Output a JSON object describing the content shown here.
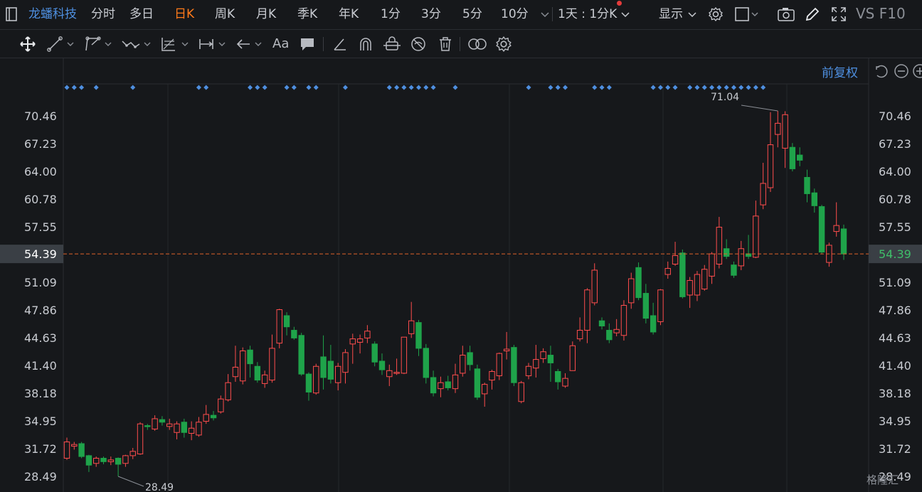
{
  "header": {
    "stock_name": "龙蟠科技",
    "tabs": [
      "分时",
      "多日",
      "日K",
      "周K",
      "月K",
      "季K",
      "年K",
      "1分",
      "3分",
      "5分",
      "10分"
    ],
    "active_tab": "日K",
    "period_selector": "1天 : 1分K",
    "display_label": "显示",
    "f10_label": "VS F10"
  },
  "toolbar": {
    "icons": [
      "move-icon",
      "line-icon",
      "polyline-icon",
      "wave-icon",
      "fib-icon",
      "measure-icon",
      "arrow-icon",
      "text-icon",
      "comment-icon",
      "pen-icon",
      "magnet-icon",
      "lock-icon",
      "hide-icon",
      "trash-icon",
      "link-icon",
      "settings-icon"
    ],
    "text_tool": "Aa"
  },
  "adjust_label": "前复权",
  "watermark": "格隆汇",
  "colors": {
    "up": "#ff4d4d",
    "down": "#1fa34a",
    "accent": "#4e8fe0",
    "active_tab": "#ff7a1a",
    "current_line": "#e0622a"
  },
  "chart_data": {
    "type": "candlestick",
    "ylim": [
      28.49,
      73.5
    ],
    "y_ticks": [
      "70.46",
      "67.23",
      "64.00",
      "60.78",
      "57.55",
      "54.39",
      "51.09",
      "47.86",
      "44.63",
      "41.40",
      "38.18",
      "34.95",
      "31.72",
      "28.49"
    ],
    "current_price": "54.39",
    "max_label": "71.04",
    "min_label": "28.49",
    "candles": [
      [
        30.6,
        32.5,
        33.0,
        30.4
      ],
      [
        32.0,
        32.2,
        32.5,
        31.6
      ],
      [
        32.3,
        30.8,
        32.5,
        30.6
      ],
      [
        30.9,
        29.8,
        31.0,
        29.0
      ],
      [
        30.0,
        30.6,
        30.8,
        29.6
      ],
      [
        30.6,
        30.2,
        30.8,
        29.9
      ],
      [
        30.2,
        30.4,
        30.8,
        29.8
      ],
      [
        30.6,
        29.9,
        30.7,
        28.49
      ],
      [
        30.0,
        30.9,
        31.0,
        29.6
      ],
      [
        30.9,
        31.4,
        31.8,
        30.5
      ],
      [
        31.1,
        34.6,
        34.8,
        31.0
      ],
      [
        34.4,
        34.3,
        34.6,
        33.9
      ],
      [
        34.0,
        35.2,
        35.6,
        33.8
      ],
      [
        35.1,
        34.8,
        35.5,
        34.4
      ],
      [
        34.3,
        34.6,
        35.2,
        33.9
      ],
      [
        33.6,
        34.6,
        34.9,
        32.8
      ],
      [
        34.8,
        33.6,
        35.2,
        33.0
      ],
      [
        33.5,
        34.1,
        34.9,
        32.7
      ],
      [
        33.3,
        34.8,
        35.4,
        33.1
      ],
      [
        34.9,
        35.7,
        36.8,
        34.6
      ],
      [
        35.6,
        35.3,
        36.1,
        35.0
      ],
      [
        36.0,
        37.5,
        37.9,
        35.8
      ],
      [
        37.4,
        39.4,
        40.4,
        37.2
      ],
      [
        40.1,
        41.2,
        43.7,
        39.5
      ],
      [
        39.6,
        43.1,
        43.5,
        39.2
      ],
      [
        43.2,
        41.6,
        43.7,
        40.0
      ],
      [
        41.3,
        39.7,
        41.8,
        39.4
      ],
      [
        39.3,
        40.3,
        40.8,
        38.8
      ],
      [
        39.7,
        43.4,
        45.0,
        39.4
      ],
      [
        44.0,
        47.9,
        48.0,
        43.4
      ],
      [
        47.2,
        45.9,
        47.6,
        44.9
      ],
      [
        45.5,
        44.6,
        45.9,
        44.4
      ],
      [
        44.9,
        40.4,
        45.2,
        40.2
      ],
      [
        40.4,
        38.3,
        40.6,
        37.3
      ],
      [
        38.2,
        41.3,
        41.6,
        38.0
      ],
      [
        42.4,
        40.0,
        44.9,
        38.6
      ],
      [
        41.9,
        39.8,
        43.8,
        39.3
      ],
      [
        39.4,
        41.3,
        41.7,
        38.5
      ],
      [
        40.6,
        42.9,
        43.3,
        39.3
      ],
      [
        43.9,
        44.5,
        45.1,
        41.6
      ],
      [
        44.1,
        44.5,
        45.0,
        42.8
      ],
      [
        44.6,
        45.4,
        46.1,
        44.0
      ],
      [
        43.9,
        41.8,
        44.2,
        41.3
      ],
      [
        41.9,
        40.9,
        42.8,
        40.3
      ],
      [
        40.1,
        40.8,
        41.5,
        39.0
      ],
      [
        40.6,
        40.6,
        42.2,
        40.3
      ],
      [
        40.5,
        44.7,
        44.7,
        40.4
      ],
      [
        45.1,
        46.6,
        48.8,
        44.6
      ],
      [
        46.4,
        43.4,
        46.7,
        42.5
      ],
      [
        43.4,
        40.0,
        43.9,
        39.3
      ],
      [
        40.0,
        38.2,
        40.8,
        37.8
      ],
      [
        38.7,
        39.4,
        40.1,
        37.7
      ],
      [
        39.5,
        38.8,
        40.2,
        38.5
      ],
      [
        38.7,
        40.3,
        41.6,
        38.2
      ],
      [
        40.5,
        42.6,
        43.7,
        40.1
      ],
      [
        42.9,
        41.5,
        43.7,
        40.8
      ],
      [
        41.0,
        37.7,
        41.5,
        37.4
      ],
      [
        38.1,
        39.2,
        39.4,
        36.6
      ],
      [
        39.7,
        40.7,
        40.9,
        38.6
      ],
      [
        40.2,
        42.8,
        42.9,
        39.7
      ],
      [
        43.1,
        43.3,
        45.3,
        42.1
      ],
      [
        43.5,
        39.4,
        43.8,
        39.0
      ],
      [
        37.2,
        39.4,
        39.6,
        37.0
      ],
      [
        40.2,
        41.3,
        41.7,
        39.8
      ],
      [
        41.1,
        42.1,
        43.8,
        40.0
      ],
      [
        42.2,
        43.0,
        43.4,
        41.7
      ],
      [
        42.6,
        41.7,
        43.7,
        39.5
      ],
      [
        40.7,
        39.5,
        41.0,
        38.6
      ],
      [
        39.0,
        39.9,
        40.5,
        38.8
      ],
      [
        40.8,
        43.7,
        44.2,
        40.8
      ],
      [
        44.5,
        45.5,
        47.0,
        44.2
      ],
      [
        45.5,
        50.2,
        50.4,
        44.0
      ],
      [
        48.7,
        52.5,
        53.3,
        48.4
      ],
      [
        46.6,
        46.0,
        47.0,
        45.6
      ],
      [
        45.5,
        44.4,
        46.3,
        44.0
      ],
      [
        45.2,
        45.6,
        46.8,
        44.8
      ],
      [
        44.9,
        48.4,
        49.0,
        44.3
      ],
      [
        48.7,
        51.5,
        52.2,
        48.0
      ],
      [
        52.8,
        49.3,
        53.4,
        49.0
      ],
      [
        49.8,
        46.9,
        50.9,
        46.3
      ],
      [
        47.2,
        45.3,
        48.7,
        45.0
      ],
      [
        46.5,
        50.2,
        50.3,
        46.1
      ],
      [
        52.0,
        52.7,
        53.5,
        51.5
      ],
      [
        53.2,
        54.2,
        55.8,
        53.0
      ],
      [
        54.5,
        49.4,
        54.9,
        49.2
      ],
      [
        49.6,
        51.3,
        51.7,
        48.1
      ],
      [
        49.6,
        52.0,
        52.4,
        48.9
      ],
      [
        50.3,
        52.6,
        53.1,
        50.1
      ],
      [
        51.8,
        54.4,
        54.6,
        50.9
      ],
      [
        53.2,
        57.5,
        58.7,
        52.7
      ],
      [
        55.0,
        54.1,
        56.1,
        53.8
      ],
      [
        53.1,
        51.9,
        53.5,
        51.6
      ],
      [
        53.0,
        55.0,
        55.9,
        52.5
      ],
      [
        54.4,
        54.1,
        56.6,
        53.8
      ],
      [
        54.0,
        58.8,
        60.6,
        53.9
      ],
      [
        60.1,
        62.6,
        65.0,
        59.6
      ],
      [
        62.1,
        67.1,
        70.9,
        61.6
      ],
      [
        68.3,
        69.6,
        71.04,
        66.8
      ],
      [
        66.7,
        70.6,
        71.0,
        64.4
      ],
      [
        66.8,
        64.3,
        67.3,
        64.0
      ],
      [
        65.9,
        65.3,
        66.8,
        64.6
      ],
      [
        63.3,
        61.4,
        64.2,
        60.4
      ],
      [
        61.5,
        60.0,
        62.0,
        59.2
      ],
      [
        59.9,
        54.6,
        60.1,
        54.4
      ],
      [
        53.4,
        55.4,
        55.7,
        52.9
      ],
      [
        57.0,
        57.7,
        60.4,
        56.4
      ],
      [
        57.3,
        54.39,
        57.8,
        53.7
      ]
    ],
    "event_markers": [
      0,
      1,
      2,
      4,
      9,
      18,
      19,
      25,
      26,
      27,
      30,
      31,
      33,
      34,
      38,
      44,
      45,
      46,
      47,
      48,
      49,
      50,
      53,
      63,
      66,
      67,
      68,
      72,
      73,
      74,
      80,
      81,
      82,
      83,
      85,
      86,
      87,
      88,
      89,
      90,
      91,
      92,
      93,
      94,
      95
    ]
  }
}
